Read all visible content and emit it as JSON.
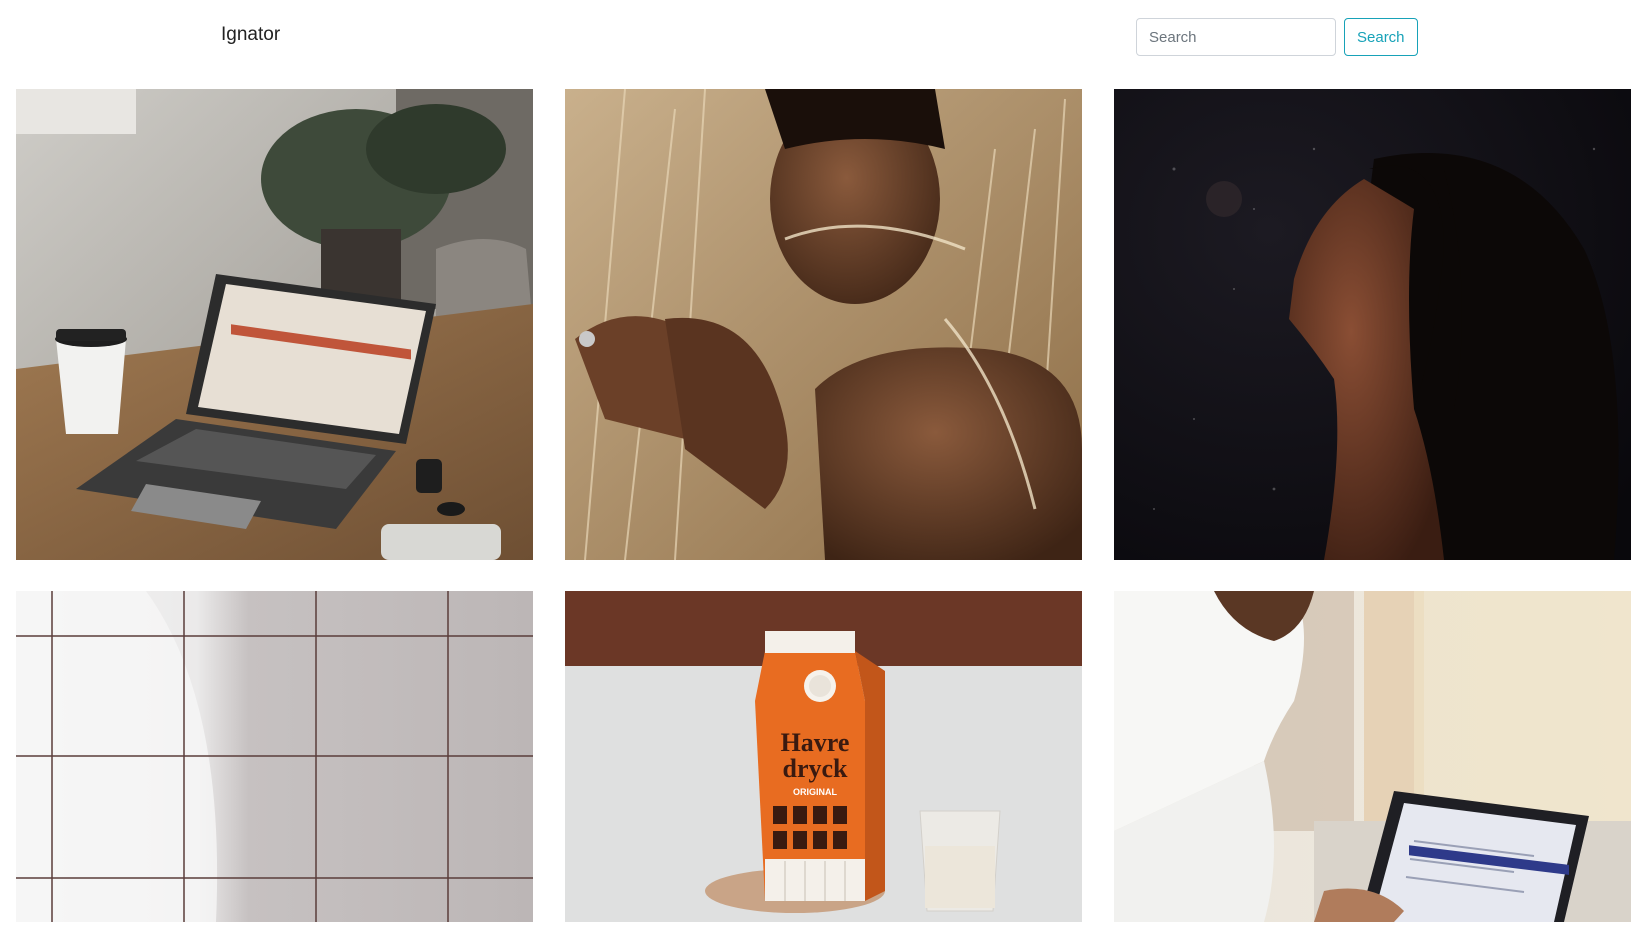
{
  "navbar": {
    "brand": "Ignator",
    "search": {
      "placeholder": "Search",
      "value": "",
      "button_label": "Search"
    }
  },
  "gallery": {
    "photos": [
      {
        "subject": "laptop-on-wooden-table"
      },
      {
        "subject": "man-in-wheat-field"
      },
      {
        "subject": "woman-profile-dark-background"
      },
      {
        "subject": "white-tile-wall"
      },
      {
        "subject": "oat-milk-carton",
        "carton_text": [
          "Havre",
          "dryck",
          "ORIGINAL"
        ]
      },
      {
        "subject": "man-using-laptop"
      }
    ]
  },
  "colors": {
    "accent": "#17a2b8",
    "border": "#cfd4da"
  }
}
